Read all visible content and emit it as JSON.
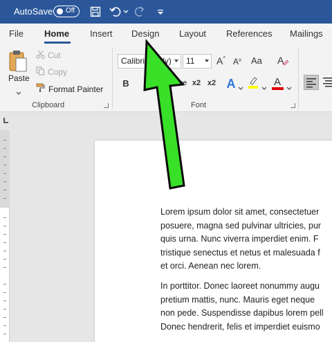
{
  "titlebar": {
    "autosave_label": "AutoSave",
    "autosave_state": "Off",
    "icons": [
      "save-icon",
      "undo-icon",
      "undo-dropdown-icon",
      "redo-icon",
      "customize-quick-access-icon"
    ]
  },
  "tabs": [
    {
      "label": "File",
      "active": false
    },
    {
      "label": "Home",
      "active": true
    },
    {
      "label": "Insert",
      "active": false
    },
    {
      "label": "Design",
      "active": false
    },
    {
      "label": "Layout",
      "active": false
    },
    {
      "label": "References",
      "active": false
    },
    {
      "label": "Mailings",
      "active": false
    }
  ],
  "clipboard": {
    "paste_label": "Paste",
    "cut_label": "Cut",
    "copy_label": "Copy",
    "format_painter_label": "Format Painter",
    "group_label": "Clipboard"
  },
  "font": {
    "font_name": "Calibri (Body)",
    "font_size": "11",
    "group_label": "Font",
    "bold_glyph": "B",
    "strike_glyph": "abc",
    "sub_glyph": "x2",
    "sup_glyph": "x2",
    "text_effects_glyph": "A",
    "font_color_glyph": "A",
    "grow_glyph": "A",
    "shrink_glyph": "A",
    "case_glyph": "Aa",
    "highlight_color": "#ffff00",
    "font_color": "#e00000"
  },
  "colors": {
    "title_bar": "#2b579a",
    "arrow_fill": "#39e028",
    "arrow_stroke": "#0a0a0a"
  },
  "document": {
    "paragraph1": [
      "Lorem ipsum dolor sit amet, consectetuer",
      "posuere, magna sed pulvinar ultricies, pur",
      "quis urna. Nunc viverra imperdiet enim. F",
      "tristique senectus et netus et malesuada f",
      "et orci. Aenean nec lorem."
    ],
    "paragraph2": [
      "In porttitor. Donec laoreet nonummy augu",
      "pretium mattis, nunc. Mauris eget neque",
      "non pede. Suspendisse dapibus lorem pell",
      "Donec hendrerit, felis et imperdiet euismo"
    ]
  }
}
